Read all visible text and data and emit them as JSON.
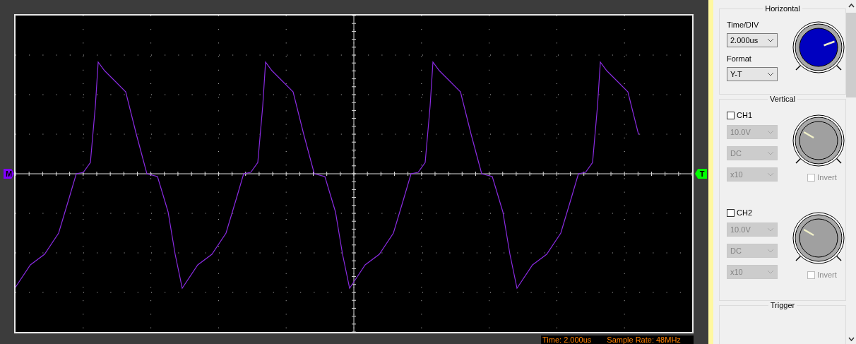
{
  "scope": {
    "ground_marker": "M",
    "trigger_marker": "T"
  },
  "status_bar": {
    "time": "Time: 2.000us",
    "sample_rate": "Sample Rate: 48MHz"
  },
  "horizontal": {
    "title": "Horizontal",
    "fields": [
      {
        "label": "Time/DIV",
        "value": "2.000us"
      },
      {
        "label": "Format",
        "value": "Y-T"
      }
    ]
  },
  "vertical": {
    "title": "Vertical",
    "channels": [
      {
        "label": "CH1",
        "checked": false,
        "volts": "10.0V",
        "coupling": "DC",
        "probe": "x10",
        "invert_label": "Invert",
        "invert_checked": false
      },
      {
        "label": "CH2",
        "checked": false,
        "volts": "10.0V",
        "coupling": "DC",
        "probe": "x10",
        "invert_label": "Invert",
        "invert_checked": false
      }
    ]
  },
  "trigger": {
    "title": "Trigger"
  }
}
